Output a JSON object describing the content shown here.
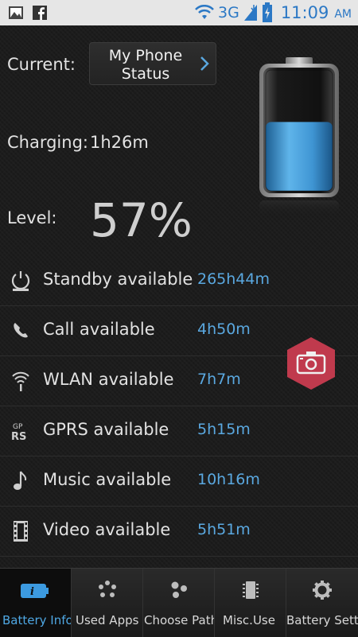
{
  "status_bar": {
    "network": "3G",
    "time": "11:09",
    "ampm": "AM",
    "icons": [
      "gallery-icon",
      "facebook-icon",
      "wifi-icon",
      "signal-icon",
      "battery-charging-icon"
    ]
  },
  "header": {
    "current_label": "Current:",
    "profile_line1": "My Phone",
    "profile_line2": "Status",
    "charging_label": "Charging:",
    "charging_value": "1h26m",
    "level_label": "Level:",
    "level_value": "57%",
    "battery_level": 0.57
  },
  "rows": [
    {
      "label": "Standby available",
      "value": "265h44m",
      "icon": "standby-icon"
    },
    {
      "label": "Call available",
      "value": "4h50m",
      "icon": "phone-icon"
    },
    {
      "label": "WLAN available",
      "value": "7h7m",
      "icon": "wifi-icon"
    },
    {
      "label": "GPRS available",
      "value": "5h15m",
      "icon": "gprs-icon"
    },
    {
      "label": "Music available",
      "value": "10h16m",
      "icon": "music-note-icon"
    },
    {
      "label": "Video available",
      "value": "5h51m",
      "icon": "film-icon"
    }
  ],
  "tabs": [
    {
      "label": "Battery Info",
      "icon": "battery-info-icon",
      "active": true
    },
    {
      "label": "Used Apps",
      "icon": "apps-dots-icon",
      "active": false
    },
    {
      "label": "Choose Path",
      "icon": "path-dots-icon",
      "active": false
    },
    {
      "label": "Misc.Use",
      "icon": "chip-icon",
      "active": false
    },
    {
      "label": "Battery Settings",
      "icon": "gear-icon",
      "active": false
    }
  ],
  "colors": {
    "accent": "#4fa8e4",
    "value": "#5aa8e0",
    "fab": "#c03a4d",
    "statusbar": "#e6e6e6"
  }
}
